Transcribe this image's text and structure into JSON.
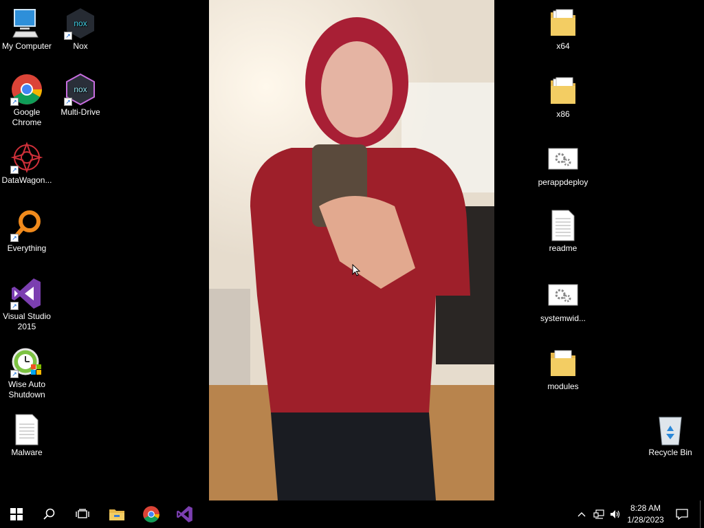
{
  "desktop": {
    "left_icons": [
      {
        "label": "My Computer",
        "icon": "computer-icon"
      },
      {
        "label": "Nox",
        "icon": "nox-icon"
      },
      {
        "label": "Google Chrome",
        "icon": "chrome-icon"
      },
      {
        "label": "Multi-Drive",
        "icon": "multi-drive-icon"
      },
      {
        "label": "DataWagon...",
        "icon": "datawagon-icon"
      },
      {
        "label": "Everything",
        "icon": "everything-icon"
      },
      {
        "label": "Visual Studio 2015",
        "icon": "visual-studio-icon"
      },
      {
        "label": "Wise Auto Shutdown",
        "icon": "wise-auto-shutdown-icon"
      },
      {
        "label": "Malware",
        "icon": "document-icon"
      }
    ],
    "right_icons": [
      {
        "label": "x64",
        "icon": "folder-icon"
      },
      {
        "label": "x86",
        "icon": "folder-icon"
      },
      {
        "label": "perappdeploy",
        "icon": "settings-file-icon"
      },
      {
        "label": "readme",
        "icon": "text-file-icon"
      },
      {
        "label": "systemwid...",
        "icon": "settings-file-icon"
      },
      {
        "label": "modules",
        "icon": "folder-icon"
      },
      {
        "label": "Recycle Bin",
        "icon": "recycle-bin-icon"
      }
    ]
  },
  "taskbar": {
    "pinned": [
      "start-icon",
      "search-icon",
      "task-view-icon",
      "file-explorer-icon",
      "chrome-icon",
      "visual-studio-icon"
    ],
    "tray": [
      "show-hidden-icons-icon",
      "network-icon",
      "volume-icon"
    ],
    "time": "8:28 AM",
    "date": "1/28/2023",
    "notification": "action-center-icon"
  },
  "colors": {
    "taskbar": "#000000",
    "folder": "#f3cd63",
    "vs_purple": "#7b3fb0"
  }
}
